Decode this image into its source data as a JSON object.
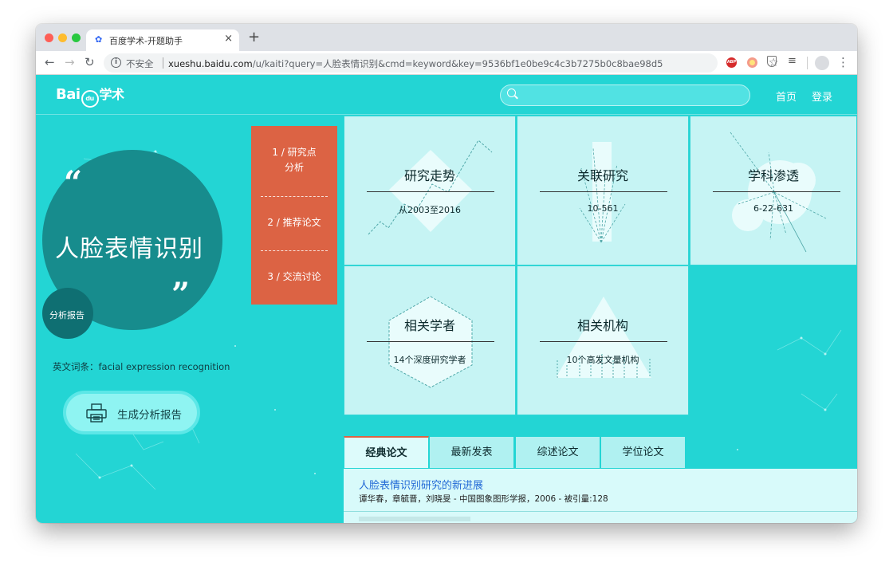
{
  "browser": {
    "tab_title": "百度学术-开题助手",
    "tab_close": "×",
    "new_tab": "+",
    "security": "不安全",
    "url_host": "xueshu.baidu.com",
    "url_path": "/u/kaiti?query=人脸表情识别&cmd=keyword&key=9536bf1e0be9c4c3b7275b0c8bae98d5",
    "extension_abp": "ABP"
  },
  "header": {
    "logo_text_1": "Bai",
    "logo_paw": "du",
    "logo_text_2": "学术",
    "search_placeholder": "",
    "nav": {
      "home": "首页",
      "login": "登录"
    }
  },
  "hero": {
    "quote_open": "“",
    "quote_close": "”",
    "topic": "人脸表情识别",
    "report_tag": "分析报告",
    "english_term": "英文词条：facial expression recognition",
    "generate_button": "生成分析报告"
  },
  "steps": [
    {
      "label_line1": "1 / 研究点",
      "label_line2": "分析"
    },
    {
      "label_line1": "2 / 推荐论文",
      "label_line2": ""
    },
    {
      "label_line1": "3 / 交流讨论",
      "label_line2": ""
    }
  ],
  "cards": [
    {
      "title": "研究走势",
      "sub": "从2003至2016"
    },
    {
      "title": "关联研究",
      "sub": "10-561"
    },
    {
      "title": "学科渗透",
      "sub": "6-22-631"
    },
    {
      "title": "相关学者",
      "sub": "14个深度研究学者"
    },
    {
      "title": "相关机构",
      "sub": "10个高发文量机构"
    }
  ],
  "paper_tabs": [
    "经典论文",
    "最新发表",
    "综述论文",
    "学位论文"
  ],
  "papers": [
    {
      "title": "人脸表情识别研究的新进展",
      "meta": "谭华春，章毓晋，刘晓旻 - 中国图象图形学报，2006 - 被引量:128"
    }
  ],
  "colors": {
    "page_bg": "#23d5d4",
    "accent": "#dc6344",
    "card_bg": "#c6f4f4",
    "circle": "#178c8d"
  }
}
